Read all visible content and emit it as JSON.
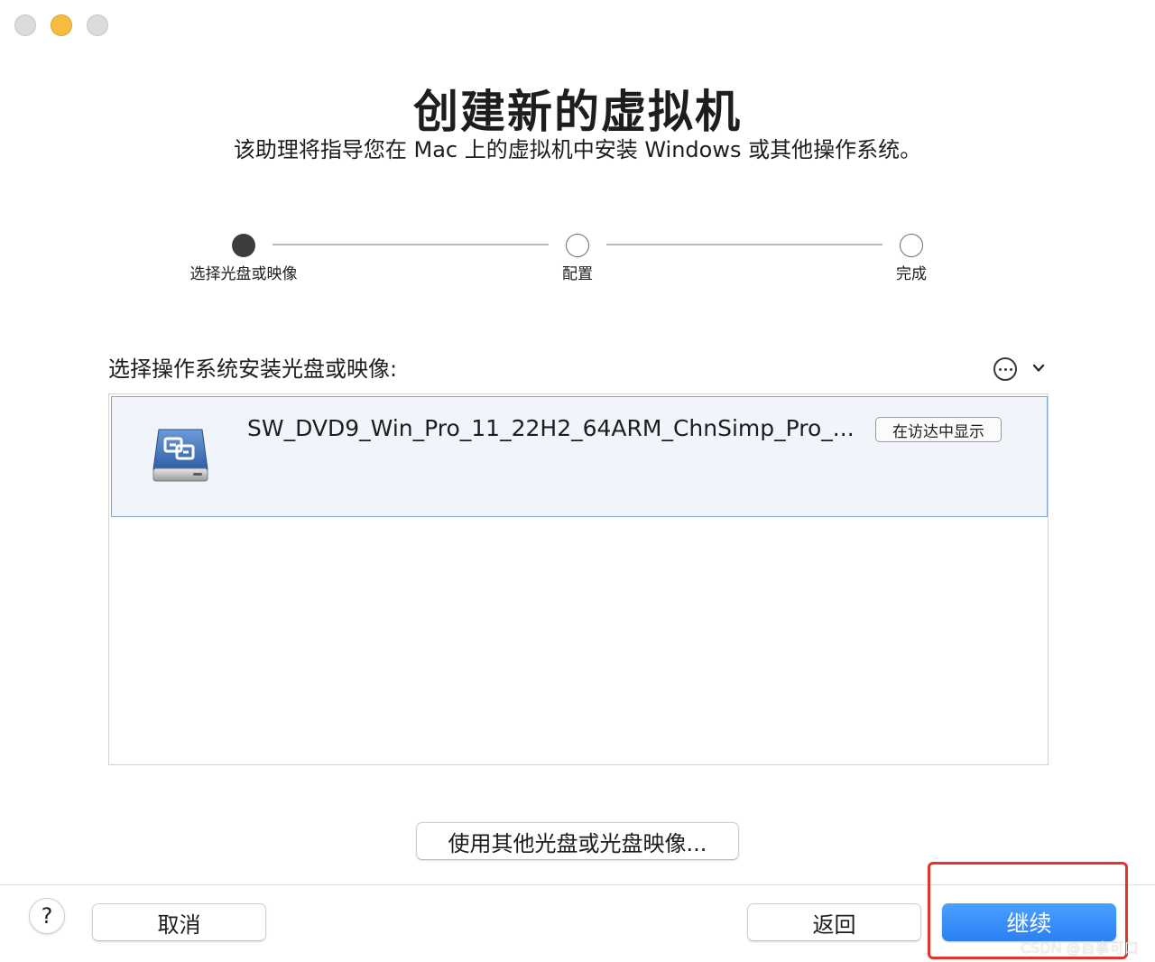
{
  "window": {
    "title": "创建新的虚拟机",
    "subtitle": "该助理将指导您在 Mac 上的虚拟机中安装 Windows 或其他操作系统。"
  },
  "stepper": {
    "steps": [
      {
        "label": "选择光盘或映像",
        "state": "active"
      },
      {
        "label": "配置",
        "state": "inactive"
      },
      {
        "label": "完成",
        "state": "inactive"
      }
    ]
  },
  "source_list": {
    "label": "选择操作系统安装光盘或映像:",
    "items": [
      {
        "name": "SW_DVD9_Win_Pro_11_22H2_64ARM_ChnSimp_Pro_...",
        "show_in_finder_label": "在访达中显示",
        "icon": "disk-image-icon"
      }
    ],
    "more_icon": "ellipsis-circle-icon",
    "dropdown_icon": "chevron-down-icon"
  },
  "buttons": {
    "other_disc": "使用其他光盘或光盘映像...",
    "help": "?",
    "cancel": "取消",
    "back": "返回",
    "continue": "继续"
  },
  "watermark": "CSDN @百事可口",
  "colors": {
    "accent": "#2b80f4",
    "highlight": "#e2332c",
    "selection_bg": "#f1f5fb",
    "selection_border": "#7ea6d8"
  }
}
